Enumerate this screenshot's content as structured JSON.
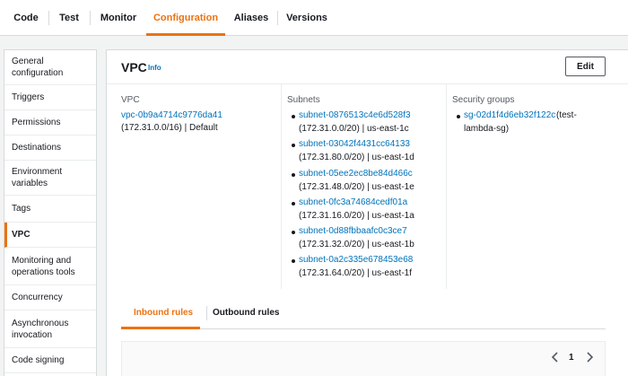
{
  "tabs": [
    {
      "label": "Code"
    },
    {
      "label": "Test"
    },
    {
      "label": "Monitor"
    },
    {
      "label": "Configuration",
      "active": true
    },
    {
      "label": "Aliases"
    },
    {
      "label": "Versions"
    }
  ],
  "sidebar": {
    "items": [
      {
        "label": "General configuration"
      },
      {
        "label": "Triggers"
      },
      {
        "label": "Permissions"
      },
      {
        "label": "Destinations"
      },
      {
        "label": "Environment variables"
      },
      {
        "label": "Tags"
      },
      {
        "label": "VPC",
        "active": true
      },
      {
        "label": "Monitoring and operations tools"
      },
      {
        "label": "Concurrency"
      },
      {
        "label": "Asynchronous invocation"
      },
      {
        "label": "Code signing"
      }
    ]
  },
  "panel": {
    "title": "VPC",
    "info_label": "Info",
    "edit_label": "Edit",
    "vpc": {
      "label": "VPC",
      "id": "vpc-0b9a4714c9776da41",
      "detail": "(172.31.0.0/16) | Default"
    },
    "subnets": {
      "label": "Subnets",
      "items": [
        {
          "id": "subnet-0876513c4e6d528f3",
          "detail": "(172.31.0.0/20) | us-east-1c"
        },
        {
          "id": "subnet-03042f4431cc64133",
          "detail": "(172.31.80.0/20) | us-east-1d"
        },
        {
          "id": "subnet-05ee2ec8be84d466c",
          "detail": "(172.31.48.0/20) | us-east-1e"
        },
        {
          "id": "subnet-0fc3a74684cedf01a",
          "detail": "(172.31.16.0/20) | us-east-1a"
        },
        {
          "id": "subnet-0d88fbbaafc0c3ce7",
          "detail": "(172.31.32.0/20) | us-east-1b"
        },
        {
          "id": "subnet-0a2c335e678453e68",
          "detail": "(172.31.64.0/20) | us-east-1f"
        }
      ]
    },
    "security_groups": {
      "label": "Security groups",
      "items": [
        {
          "id": "sg-02d1f4d6eb32f122c",
          "name_line1": "(test-",
          "name_line2": "lambda-sg)"
        }
      ]
    }
  },
  "rules": {
    "tabs": [
      {
        "label": "Inbound rules",
        "active": true
      },
      {
        "label": "Outbound rules"
      }
    ],
    "pagination": {
      "prev_icon": "chevron-left-icon",
      "current_page": "1",
      "next_icon": "chevron-right-icon"
    }
  },
  "colors": {
    "accent": "#ec7211",
    "link": "#0073bb",
    "border": "#d5dbdb",
    "background": "#f2f3f3"
  }
}
